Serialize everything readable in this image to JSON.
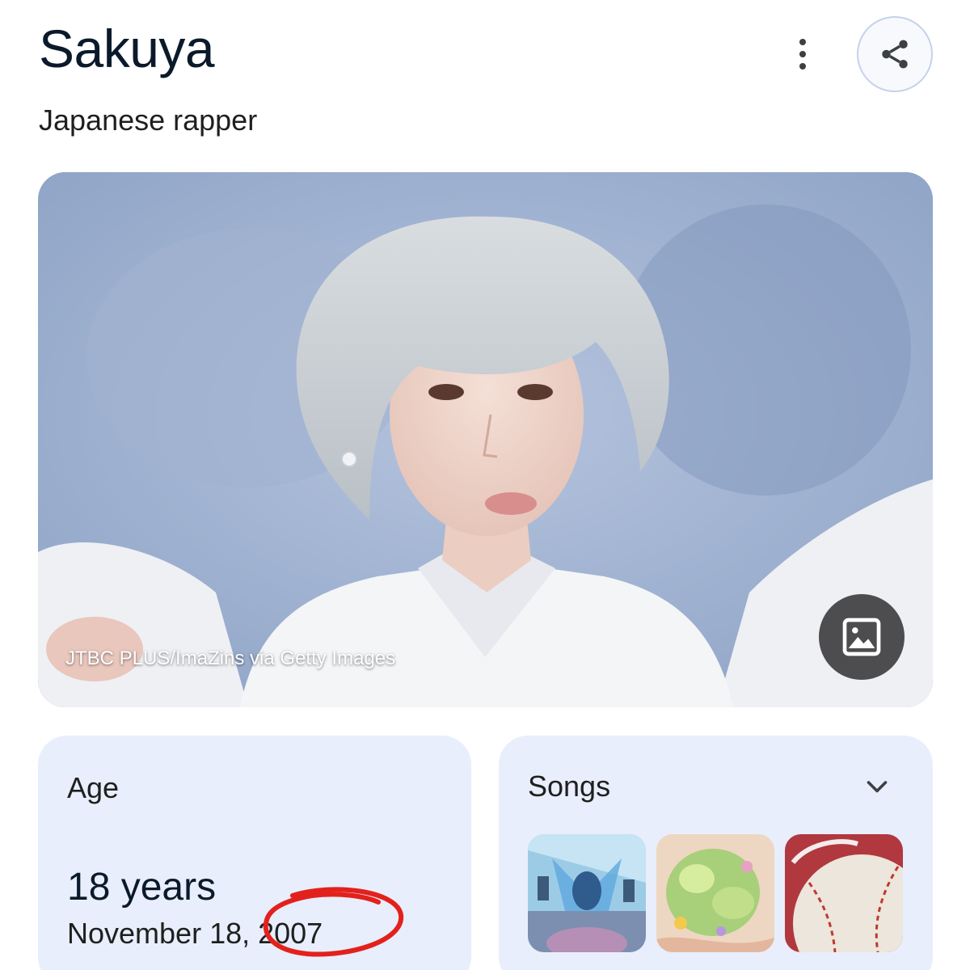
{
  "header": {
    "title": "Sakuya",
    "subtitle": "Japanese rapper",
    "more_icon": "more-vert-icon",
    "share_icon": "share-icon"
  },
  "hero": {
    "credit": "JTBC PLUS/ImaZins via Getty Images",
    "image_button_icon": "image-icon"
  },
  "age_card": {
    "label": "Age",
    "value": "18 years",
    "birthdate": "November 18, 2007",
    "annotation_color": "#e3211c"
  },
  "songs_card": {
    "label": "Songs",
    "expand_icon": "chevron-down-icon"
  },
  "colors": {
    "card_background": "#e8eefb",
    "title_text": "#0b1a2b",
    "hero_backdrop": "#9fb2d2"
  }
}
